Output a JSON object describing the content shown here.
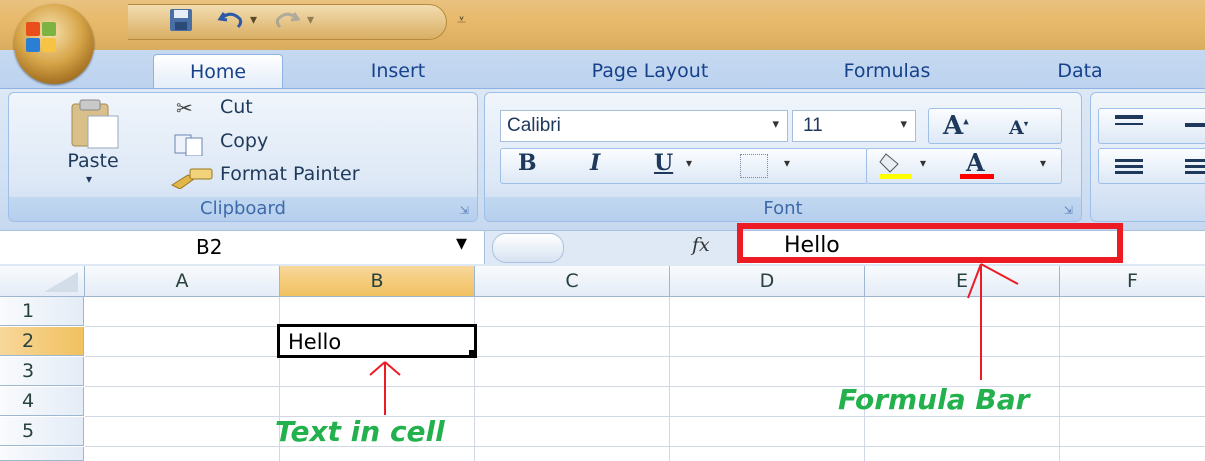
{
  "quick_access": {
    "icons": [
      "save-icon",
      "undo-icon",
      "redo-icon",
      "customize-icon"
    ]
  },
  "tabs": [
    {
      "label": "Home"
    },
    {
      "label": "Insert"
    },
    {
      "label": "Page Layout"
    },
    {
      "label": "Formulas"
    },
    {
      "label": "Data"
    }
  ],
  "clipboard": {
    "paste_label": "Paste",
    "cut_label": "Cut",
    "copy_label": "Copy",
    "format_painter_label": "Format Painter",
    "group_label": "Clipboard"
  },
  "font": {
    "font_name": "Calibri",
    "font_size": "11",
    "bold": "B",
    "italic": "I",
    "underline": "U",
    "group_label": "Font",
    "highlight_color": "#ffff00",
    "font_color": "#ff0000"
  },
  "formula_bar": {
    "name_box": "B2",
    "fx_label": "fx",
    "content": "Hello"
  },
  "sheet": {
    "columns": [
      "A",
      "B",
      "C",
      "D",
      "E",
      "F"
    ],
    "rows": [
      "1",
      "2",
      "3",
      "4",
      "5"
    ],
    "active_cell": "B2",
    "cell_B2": "Hello"
  },
  "annotations": {
    "formula_bar_label": "Formula Bar",
    "cell_label": "Text in cell",
    "annotation_color": "#22b14c",
    "highlight_box_color": "#ed1c24"
  }
}
